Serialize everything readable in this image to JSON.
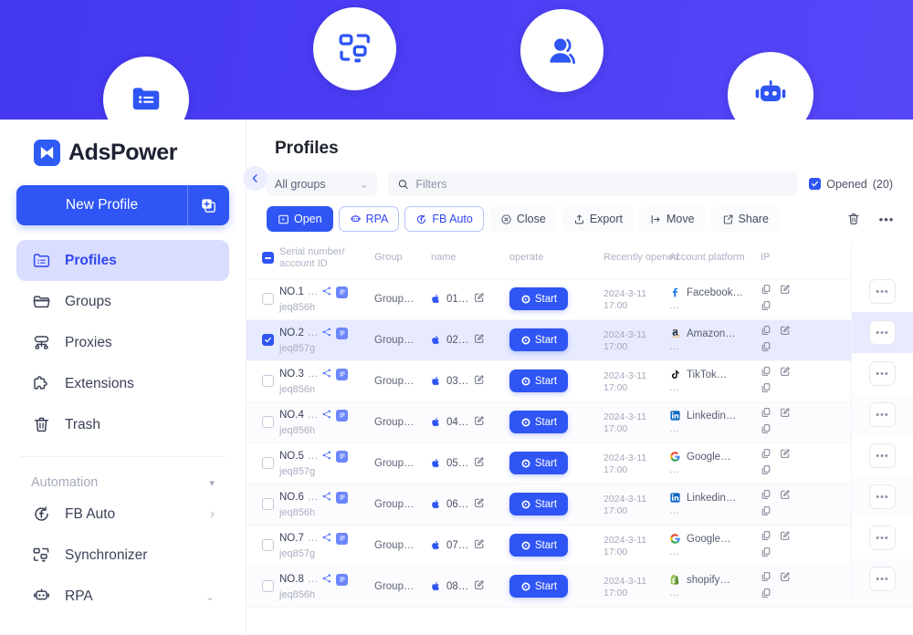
{
  "banner": {
    "icons": [
      {
        "name": "profiles-folder-icon"
      },
      {
        "name": "synchronizer-icon"
      },
      {
        "name": "user-icon"
      },
      {
        "name": "robot-rpa-icon"
      }
    ],
    "color": "#4a3df5"
  },
  "sidebar": {
    "brand": "AdsPower",
    "new_profile_label": "New Profile",
    "items": [
      {
        "label": "Profiles",
        "icon": "folder-list-icon",
        "active": true
      },
      {
        "label": "Groups",
        "icon": "folder-icon",
        "active": false
      },
      {
        "label": "Proxies",
        "icon": "proxy-icon",
        "active": false
      },
      {
        "label": "Extensions",
        "icon": "puzzle-icon",
        "active": false
      },
      {
        "label": "Trash",
        "icon": "trash-icon",
        "active": false
      }
    ],
    "section": {
      "label": "Automation",
      "caret": "▾"
    },
    "automation_items": [
      {
        "label": "FB Auto",
        "icon": "facebook-auto-icon",
        "trail": "›"
      },
      {
        "label": "Synchronizer",
        "icon": "synchronizer-icon",
        "trail": ""
      },
      {
        "label": "RPA",
        "icon": "robot-icon",
        "trail": "⌄"
      }
    ]
  },
  "main": {
    "title": "Profiles",
    "group_select": {
      "value": "All groups",
      "caret": "⌄"
    },
    "search": {
      "value": "",
      "placeholder": "Filters"
    },
    "opened": {
      "label": "Opened",
      "count": "(20)",
      "checked": true
    },
    "actions": [
      {
        "label": "Open",
        "icon": "open-window-icon",
        "style": "primary"
      },
      {
        "label": "RPA",
        "icon": "robot-icon",
        "style": "outline"
      },
      {
        "label": "FB Auto",
        "icon": "facebook-auto-icon",
        "style": "outline"
      },
      {
        "label": "Close",
        "icon": "close-circle-icon",
        "style": "plain"
      },
      {
        "label": "Export",
        "icon": "export-icon",
        "style": "plain"
      },
      {
        "label": "Move",
        "icon": "move-icon",
        "style": "plain"
      },
      {
        "label": "Share",
        "icon": "share-icon",
        "style": "plain"
      }
    ],
    "right_icons": [
      {
        "name": "trash-icon"
      },
      {
        "name": "more-dots-icon",
        "label": "•••"
      }
    ]
  },
  "table": {
    "headers": [
      "Serial number/\naccount ID",
      "Group",
      "name",
      "operate",
      "Recently opened",
      "Account platform",
      "IP"
    ],
    "header_serial_line1": "Serial number/",
    "header_serial_line2": "account ID",
    "header_group": "Group",
    "header_name": "name",
    "header_operate": "operate",
    "header_recent": "Recently opened",
    "header_platform": "Account platform",
    "header_ip": "IP",
    "start_label": "Start",
    "more_label": "•••",
    "rows": [
      {
        "serial": "NO.1",
        "dots": "…",
        "account_id": "jeq856h",
        "group": "Group…",
        "name": "01…",
        "date": "2024-3-11",
        "time": "17:00",
        "platform": "Facebook…",
        "platform_sub": "…",
        "platform_icon": "facebook-icon",
        "selected": false
      },
      {
        "serial": "NO.2",
        "dots": "…",
        "account_id": "jeq857g",
        "group": "Group…",
        "name": "02…",
        "date": "2024-3-11",
        "time": "17:00",
        "platform": "Amazon…",
        "platform_sub": "…",
        "platform_icon": "amazon-icon",
        "selected": true
      },
      {
        "serial": "NO.3",
        "dots": "…",
        "account_id": "jeq856n",
        "group": "Group…",
        "name": "03…",
        "date": "2024-3-11",
        "time": "17:00",
        "platform": "TikTok…",
        "platform_sub": "…",
        "platform_icon": "tiktok-icon",
        "selected": false
      },
      {
        "serial": "NO.4",
        "dots": "…",
        "account_id": "jeq856h",
        "group": "Group…",
        "name": "04…",
        "date": "2024-3-11",
        "time": "17:00",
        "platform": "Linkedin…",
        "platform_sub": "…",
        "platform_icon": "linkedin-icon",
        "selected": false
      },
      {
        "serial": "NO.5",
        "dots": "…",
        "account_id": "jeq857g",
        "group": "Group…",
        "name": "05…",
        "date": "2024-3-11",
        "time": "17:00",
        "platform": "Google…",
        "platform_sub": "…",
        "platform_icon": "google-icon",
        "selected": false
      },
      {
        "serial": "NO.6",
        "dots": "…",
        "account_id": "jeq856h",
        "group": "Group…",
        "name": "06…",
        "date": "2024-3-11",
        "time": "17:00",
        "platform": "Linkedin…",
        "platform_sub": "…",
        "platform_icon": "linkedin-icon",
        "selected": false
      },
      {
        "serial": "NO.7",
        "dots": "…",
        "account_id": "jeq857g",
        "group": "Group…",
        "name": "07…",
        "date": "2024-3-11",
        "time": "17:00",
        "platform": "Google…",
        "platform_sub": "…",
        "platform_icon": "google-icon",
        "selected": false
      },
      {
        "serial": "NO.8",
        "dots": "…",
        "account_id": "jeq856h",
        "group": "Group…",
        "name": "08…",
        "date": "2024-3-11",
        "time": "17:00",
        "platform": "shopify…",
        "platform_sub": "…",
        "platform_icon": "shopify-icon",
        "selected": false
      }
    ]
  },
  "colors": {
    "accent": "#2f55f4",
    "banner": "#4a3df5",
    "active_nav_bg": "#d9deff",
    "selected_row": "#e8ebff"
  }
}
